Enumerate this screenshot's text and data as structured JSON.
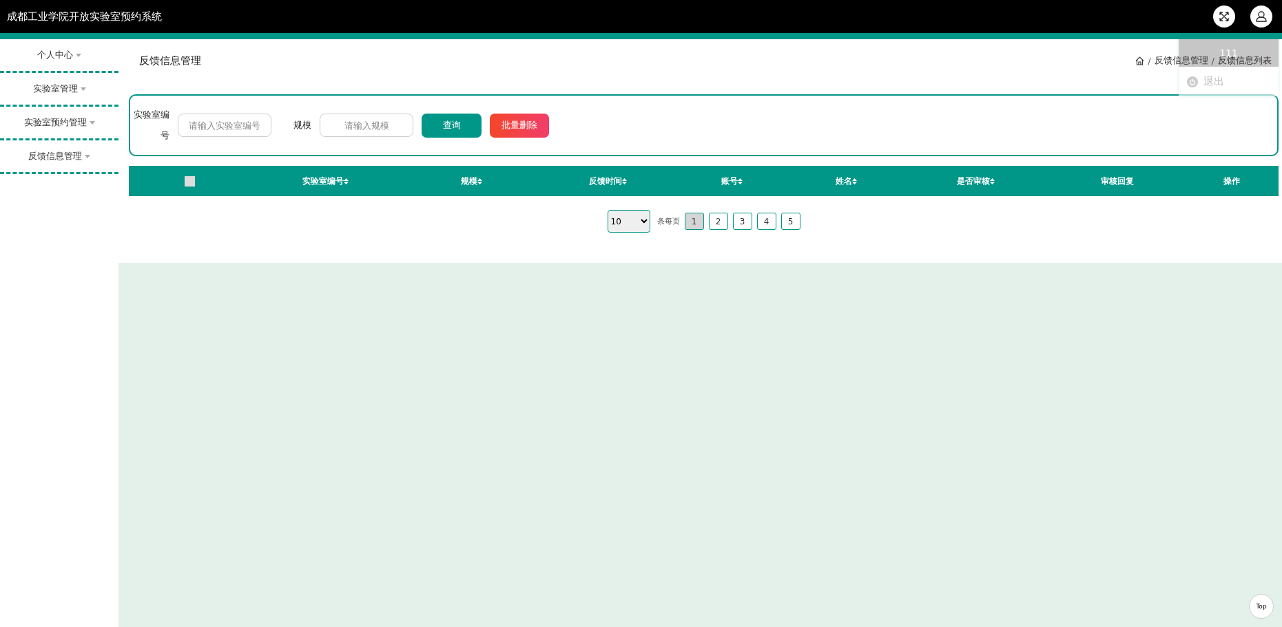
{
  "header": {
    "title": "成都工业学院开放实验室预约系统"
  },
  "user_menu": {
    "username": "111",
    "items": [
      {
        "label": "退出"
      }
    ]
  },
  "sidebar": {
    "items": [
      {
        "label": "个人中心"
      },
      {
        "label": "实验室管理"
      },
      {
        "label": "实验室预约管理"
      },
      {
        "label": "反馈信息管理"
      }
    ]
  },
  "page_title": "反馈信息管理",
  "breadcrumb": [
    {
      "separator": "/",
      "label": "反馈信息管理"
    },
    {
      "separator": "/",
      "label": "反馈信息列表"
    }
  ],
  "search": {
    "fields": [
      {
        "label": "实验室编号",
        "placeholder": "请输入实验室编号"
      },
      {
        "label": "规模",
        "placeholder": "请输入规模"
      }
    ],
    "buttons": [
      {
        "label": "查询",
        "kind": "primary"
      },
      {
        "label": "批量删除",
        "kind": "danger"
      }
    ]
  },
  "table": {
    "select_all": {
      "checked": false
    },
    "columns": [
      {
        "label": "实验室编号",
        "sortable": true
      },
      {
        "label": "规模",
        "sortable": true
      },
      {
        "label": "反馈时间",
        "sortable": true
      },
      {
        "label": "账号",
        "sortable": true
      },
      {
        "label": "姓名",
        "sortable": true
      },
      {
        "label": "是否审核",
        "sortable": true
      },
      {
        "label": "审核回复",
        "sortable": false
      },
      {
        "label": "操作",
        "sortable": false
      }
    ]
  },
  "pagination": {
    "page_size": "10",
    "per_page_label": "条每页",
    "pages": [
      {
        "label": "1",
        "selected": true
      },
      {
        "label": "2",
        "selected": false
      },
      {
        "label": "3",
        "selected": false
      },
      {
        "label": "4",
        "selected": false
      },
      {
        "label": "5",
        "selected": false
      }
    ]
  },
  "back_to_top": "Top"
}
